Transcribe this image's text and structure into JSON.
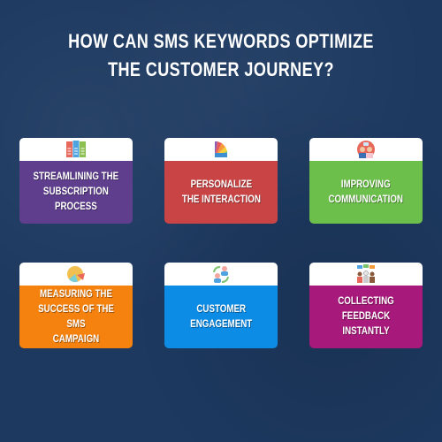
{
  "title": {
    "line1": "HOW CAN SMS KEYWORDS OPTIMIZE",
    "line2": "THE CUSTOMER JOURNEY?"
  },
  "cards": [
    {
      "label": "STREAMLINING THE\nSUBSCRIPTION\nPROCESS",
      "icon": "sms-documents-icon",
      "color": "#5f3e8e"
    },
    {
      "label": "PERSONALIZE\nTHE INTERACTION",
      "icon": "color-palette-icon",
      "color": "#c94444"
    },
    {
      "label": "IMPROVING\nCOMMUNICATION",
      "icon": "people-chat-icon",
      "color": "#6bbf4a"
    },
    {
      "label": "MEASURING THE\nSUCCESS OF THE SMS\nCAMPAIGN",
      "icon": "pie-chart-icon",
      "color": "#f5820f"
    },
    {
      "label": "CUSTOMER\nENGAGEMENT",
      "icon": "user-exchange-icon",
      "color": "#0d8ce6"
    },
    {
      "label": "COLLECTING FEEDBACK\nINSTANTLY",
      "icon": "group-feedback-icon",
      "color": "#a7197a"
    }
  ]
}
